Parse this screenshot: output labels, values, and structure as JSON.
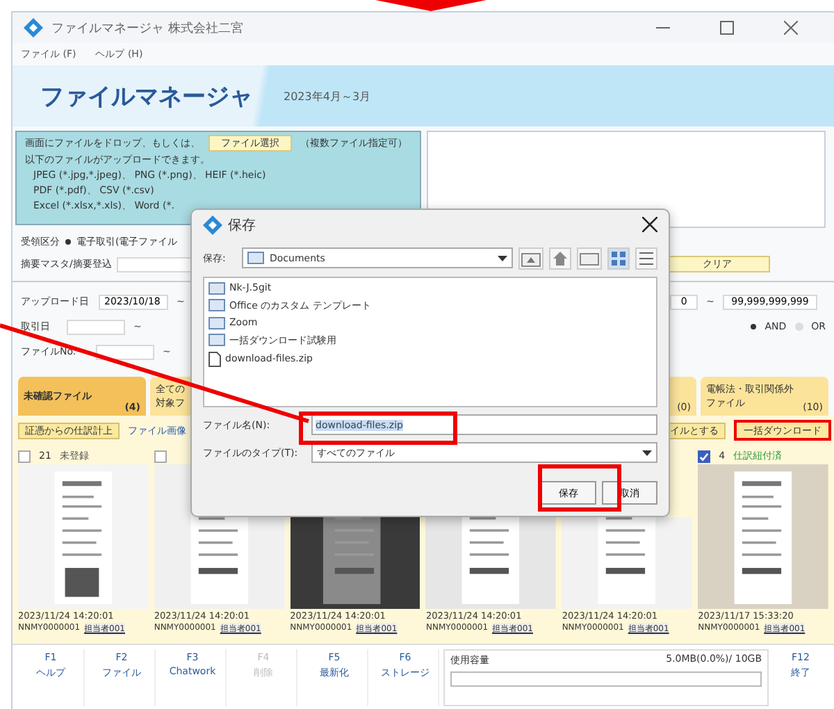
{
  "window": {
    "title": "ファイルマネージャ 株式会社二宮"
  },
  "menu": [
    "ファイル (F)",
    "ヘルプ (H)"
  ],
  "header": {
    "title": "ファイルマネージャ",
    "period": "2023年4月～3月"
  },
  "upload": {
    "before": "画面にファイルをドロップ、もしくは、",
    "button": "ファイル選択",
    "after": "（複数ファイル指定可）",
    "lines": [
      "以下のファイルがアップロードできます。",
      "JPEG (*.jpg,*.jpeg)、 PNG (*.png)、 HEIF (*.heic)",
      "PDF (*.pdf)、 CSV (*.csv)",
      "Excel (*.xlsx,*.xls)、 Word (*."
    ]
  },
  "receipt": {
    "label": "受領区分",
    "option": "電子取引(電子ファイル",
    "selected": true
  },
  "memo": {
    "label": "摘要マスタ/摘要登込"
  },
  "clear_button": "クリア",
  "search": {
    "upload_date": {
      "label": "アップロード日",
      "from": "2023/10/18",
      "sep": "~"
    },
    "trade_date": {
      "label": "取引日",
      "sep": "~"
    },
    "file_no": {
      "label": "ファイルNo.",
      "sep": "~"
    },
    "amount": {
      "from": "0",
      "sep": "~",
      "to": "99,999,999,999"
    },
    "logic": [
      {
        "label": "AND",
        "selected": true
      },
      {
        "label": "OR",
        "selected": false
      }
    ]
  },
  "tabs": [
    {
      "lines": [
        "未確認ファイル"
      ],
      "count": "(4)",
      "selected": true
    },
    {
      "lines": [
        "全ての",
        "対象フ"
      ],
      "selected": false
    },
    {
      "count": "(0)",
      "selected": false
    },
    {
      "lines": [
        "電帳法・取引関係外",
        "ファイル"
      ],
      "count": "(10)",
      "selected": false
    }
  ],
  "actions": [
    {
      "label": "証憑からの仕訳計上",
      "kind": "button"
    },
    {
      "label": "ファイル画像",
      "kind": "link"
    },
    {
      "label": "イルとする",
      "kind": "button"
    },
    {
      "label": "一括ダウンロード",
      "kind": "button"
    }
  ],
  "cards": [
    {
      "checked": false,
      "number": "21",
      "status": "未登録",
      "color": "#555555",
      "date": "2023/11/24 14:20:01",
      "code": "NNMY0000001",
      "owner": "担当者001"
    },
    {
      "checked": false,
      "date": "2023/11/24 14:20:01",
      "code": "NNMY0000001",
      "owner": "担当者001"
    },
    {
      "date": "2023/11/24 14:20:01",
      "code": "NNMY0000001",
      "owner": "担当者001"
    },
    {
      "date": "2023/11/24 14:20:01",
      "code": "NNMY0000001",
      "owner": "担当者001"
    },
    {
      "date": "2023/11/24 14:20:01",
      "code": "NNMY0000001",
      "owner": "担当者001"
    },
    {
      "checked": true,
      "number": "4",
      "status": "仕訳紐付済",
      "color": "#2a9a3a",
      "date": "2023/11/17 15:33:20",
      "code": "NNMY0000001",
      "owner": "担当者001"
    }
  ],
  "fkeys": [
    {
      "key": "F1",
      "lines": [
        "ヘルプ"
      ],
      "disabled": false
    },
    {
      "key": "F2",
      "lines": [
        "ファイル"
      ],
      "disabled": false
    },
    {
      "key": "F3",
      "lines": [
        "Chatwork"
      ],
      "disabled": false
    },
    {
      "key": "F4",
      "lines": [
        "削除"
      ],
      "disabled": true
    },
    {
      "key": "F5",
      "lines": [
        "最新化"
      ],
      "disabled": false
    },
    {
      "key": "F6",
      "lines": [
        "ストレージ"
      ],
      "disabled": false
    }
  ],
  "storage": {
    "label": "使用容量",
    "usage": "5.0MB(0.0%)/ 10GB",
    "level": 0.0
  },
  "exit_key": {
    "key": "F12",
    "label": "終了"
  },
  "dialog": {
    "title": "保存",
    "save_in_label": "保存:",
    "folder": "Documents",
    "items": [
      {
        "name": "Nk-J.5git",
        "kind": "folder"
      },
      {
        "name": "Office のカスタム テンプレート",
        "kind": "folder"
      },
      {
        "name": "Zoom",
        "kind": "folder"
      },
      {
        "name": "一括ダウンロード試験用",
        "kind": "folder"
      },
      {
        "name": "download-files.zip",
        "kind": "file"
      }
    ],
    "filename_label": "ファイル名(N):",
    "filename": "download-files.zip",
    "type_label": "ファイルのタイプ(T):",
    "type": "すべてのファイル",
    "buttons": [
      "保存",
      "取消"
    ]
  }
}
